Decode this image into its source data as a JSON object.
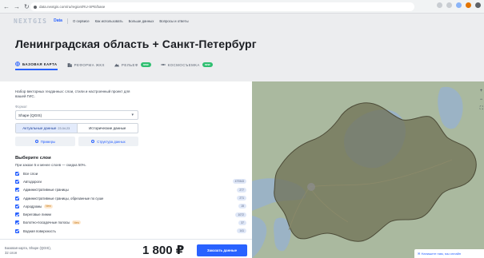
{
  "browser": {
    "url": "data.nextgis.com/ru/region/RU-SPE/base"
  },
  "site": {
    "logo": "NEXTGIS",
    "product": "Data",
    "nav": [
      "О сервисе",
      "Как использовать",
      "Больше данных",
      "Вопросы и ответы"
    ]
  },
  "page": {
    "title": "Ленинградская область + Санкт-Петербург",
    "tabs": [
      {
        "label": "БАЗОВАЯ КАРТА",
        "icon": "globe-icon",
        "active": true
      },
      {
        "label": "РЕФОРМА ЖКХ",
        "icon": "building-icon",
        "active": false
      },
      {
        "label": "РЕЛЬЕФ",
        "icon": "mountain-icon",
        "badge": "new",
        "active": false
      },
      {
        "label": "КОСМОСЪЕМКА",
        "icon": "satellite-icon",
        "badge": "new",
        "active": false
      }
    ]
  },
  "panel": {
    "description": "Набор векторных геоданных: слои, стили и настроенный проект для вашей ГИС.",
    "format_label": "Формат",
    "format_value": "Shape (QGIS)",
    "segments": {
      "current": "Актуальные данные",
      "current_date": "23.04.23",
      "historical": "Исторические данные"
    },
    "buttons": {
      "examples": "Примеры",
      "structure": "Структура данных"
    },
    "layers_heading": "Выберите слои",
    "layers_subheading": "При заказе 5 и менее слоев — скидка 50%.",
    "layers": [
      {
        "label": "Все слои",
        "count": ""
      },
      {
        "label": "Автодороги",
        "count": "479343"
      },
      {
        "label": "Административные границы",
        "count": "277"
      },
      {
        "label": "Административные границы, обрезанные по суше",
        "count": "271"
      },
      {
        "label": "Аэродромы",
        "badge": "New",
        "count": "15"
      },
      {
        "label": "Береговые линии",
        "count": "1072"
      },
      {
        "label": "Болотно-посадочные полосы",
        "badge": "New",
        "count": "37"
      },
      {
        "label": "Водная поверхность",
        "count": "141"
      }
    ]
  },
  "order": {
    "summary_line1": "Базовая карта, Shape (QGIS),",
    "summary_line2": "32 слоя",
    "price": "1 800 ₽",
    "button": "Заказать данные"
  },
  "map": {
    "zoom_in": "+",
    "zoom_out": "−",
    "fullscreen": "⛶",
    "chat": "✉ Напишите нам, мы онлайн",
    "colors": {
      "water": "#9bb3c5",
      "land": "#aab99f",
      "region": "#6e6d52"
    }
  }
}
